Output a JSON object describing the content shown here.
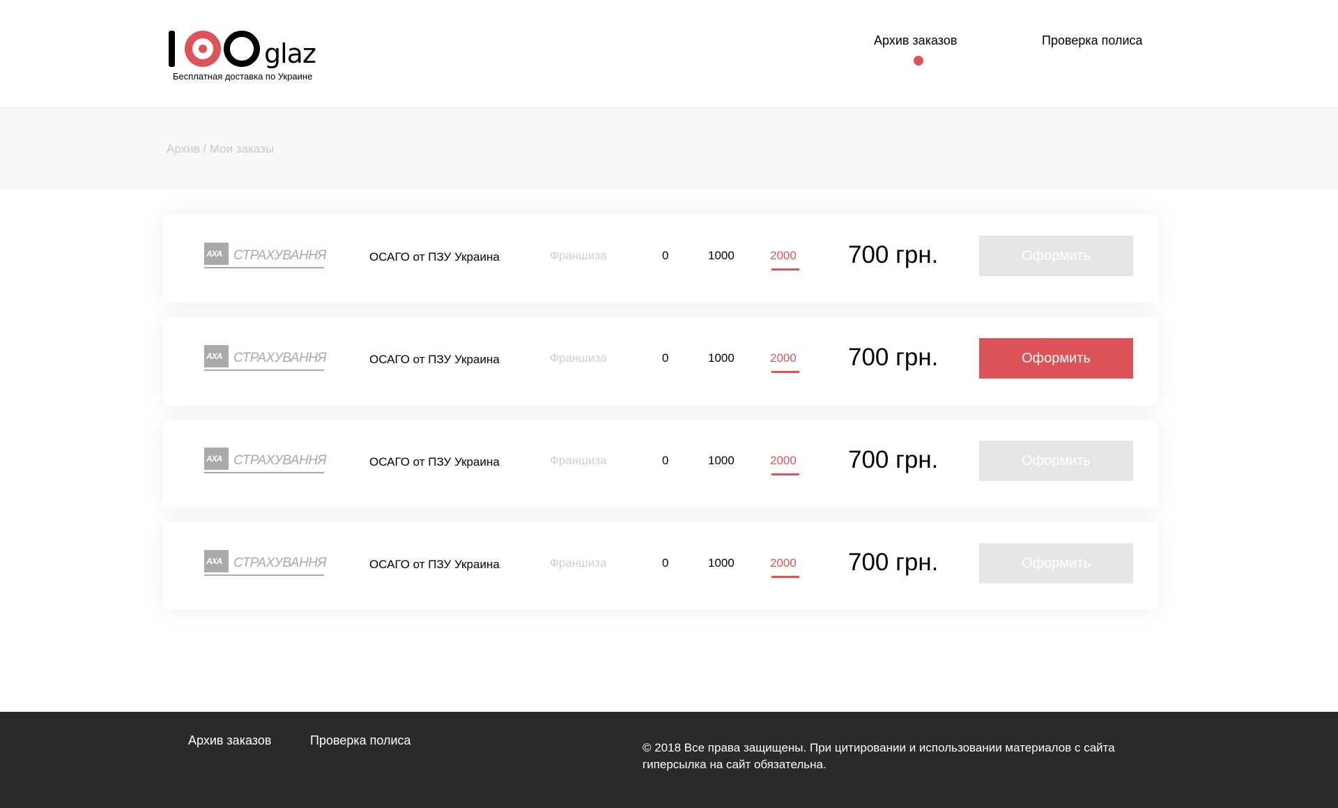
{
  "header": {
    "logo": {
      "number": "1",
      "word": "glaz",
      "tagline": "Бесплатная доставка по Украине"
    },
    "nav": [
      {
        "label": "Архив заказов",
        "active": true
      },
      {
        "label": "Проверка полиса",
        "active": false
      }
    ]
  },
  "breadcrumb": "Архив / Мои заказы",
  "offers": [
    {
      "insurer_logo_text": "СТРАХУВАННЯ",
      "insurer_mark": "AXA",
      "title": "ОСАГО от ПЗУ Украина",
      "franchise_label": "Франшиза",
      "franchise_options": [
        "0",
        "1000",
        "2000"
      ],
      "selected_option": "2000",
      "price": "700 грн.",
      "button_label": "Оформить",
      "button_active": false
    },
    {
      "insurer_logo_text": "СТРАХУВАННЯ",
      "insurer_mark": "AXA",
      "title": "ОСАГО от ПЗУ Украина",
      "franchise_label": "Франшиза",
      "franchise_options": [
        "0",
        "1000",
        "2000"
      ],
      "selected_option": "2000",
      "price": "700 грн.",
      "button_label": "Оформить",
      "button_active": true
    },
    {
      "insurer_logo_text": "СТРАХУВАННЯ",
      "insurer_mark": "AXA",
      "title": "ОСАГО от ПЗУ Украина",
      "franchise_label": "Франшиза",
      "franchise_options": [
        "0",
        "1000",
        "2000"
      ],
      "selected_option": "2000",
      "price": "700 грн.",
      "button_label": "Оформить",
      "button_active": false
    },
    {
      "insurer_logo_text": "СТРАХУВАННЯ",
      "insurer_mark": "AXA",
      "title": "ОСАГО от ПЗУ Украина",
      "franchise_label": "Франшиза",
      "franchise_options": [
        "0",
        "1000",
        "2000"
      ],
      "selected_option": "2000",
      "price": "700 грн.",
      "button_label": "Оформить",
      "button_active": false
    }
  ],
  "footer": {
    "links": [
      "Архив заказов",
      "Проверка полиса"
    ],
    "copyright": "©  2018 Все права защищены. При цитировании и использовании материалов с сайта гиперсылка на сайт обязательна."
  },
  "colors": {
    "accent": "#dd5357",
    "footer_bg": "#2a2a2a",
    "button_disabled": "#e6e6e6",
    "band_bg": "#f8f8f8"
  }
}
